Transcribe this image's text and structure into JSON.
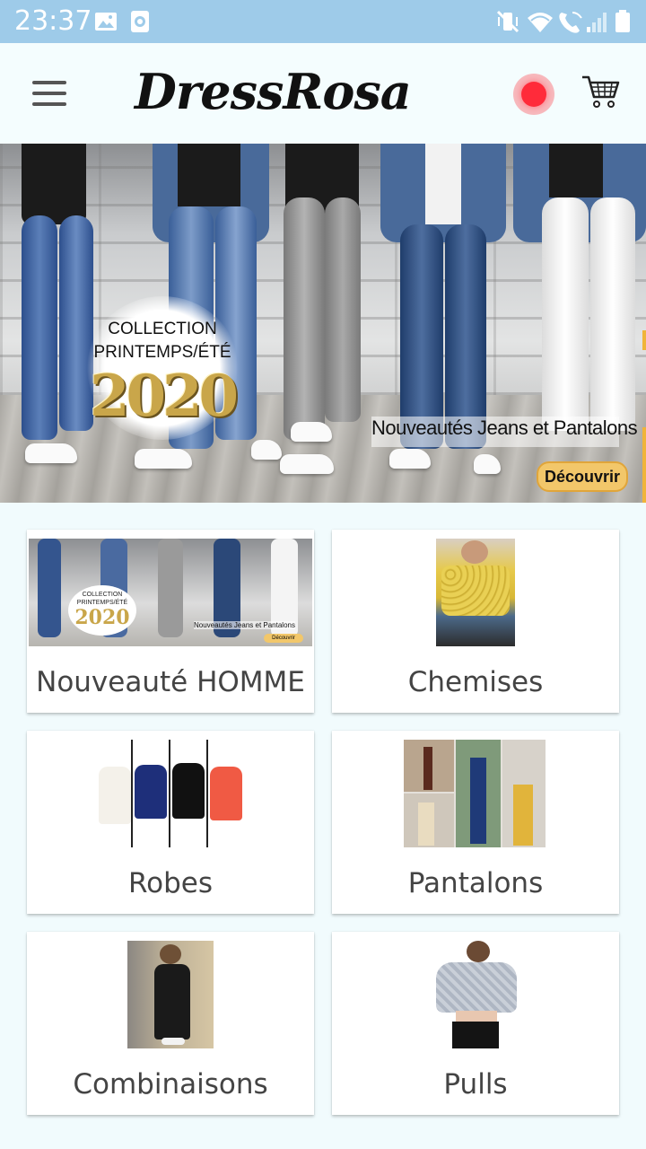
{
  "status_bar": {
    "time": "23:37",
    "left_icons": [
      "image-icon",
      "screen-record-icon"
    ],
    "right_icons": [
      "vibrate-mute-icon",
      "wifi-icon",
      "wifi-call-icon",
      "signal-icon",
      "battery-icon"
    ]
  },
  "app_bar": {
    "menu_icon": "hamburger-menu-icon",
    "brand": "DressRosa",
    "record_icon": "record-dot-icon",
    "cart_icon": "shopping-cart-icon"
  },
  "banner": {
    "collection_line1": "COLLECTION",
    "collection_line2": "PRINTEMPS/ÉTÉ",
    "year": "2020",
    "headline": "Nouveautés Jeans et Pantalons",
    "cta": "Découvrir"
  },
  "categories": [
    {
      "label": "Nouveauté HOMME"
    },
    {
      "label": "Chemises"
    },
    {
      "label": "Robes"
    },
    {
      "label": "Pantalons"
    },
    {
      "label": "Combinaisons"
    },
    {
      "label": "Pulls"
    }
  ],
  "thumb_small": {
    "collection_line1": "COLLECTION",
    "collection_line2": "PRINTEMPS/ÉTÉ",
    "year": "2020",
    "headline": "Nouveautés Jeans et Pantalons",
    "cta": "Découvrir"
  },
  "colors": {
    "status_bar": "#9ecbe9",
    "app_bar": "#f4fdfe",
    "page_bg": "#f1fbfd",
    "record_red": "#ff2b3a",
    "cta_gold": "#f2c76a"
  }
}
